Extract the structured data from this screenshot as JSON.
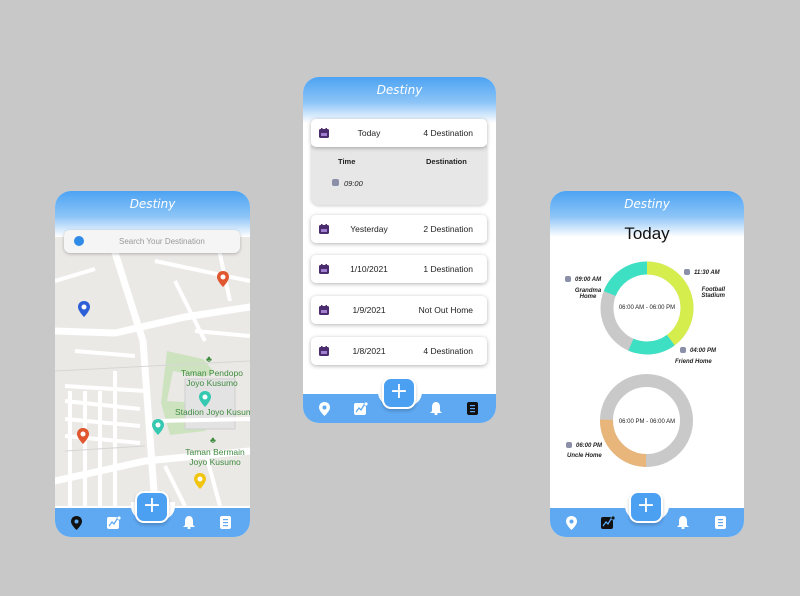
{
  "app": {
    "title": "Destiny"
  },
  "map_screen": {
    "search_placeholder": "Search Your Destination",
    "labels": {
      "pendopo": "Taman Pendopo Joyo Kusumo",
      "stadion": "Stadion Joyo Kusumo",
      "bermain": "Taman Bermain Joyo Kusumo"
    }
  },
  "list_screen": {
    "today": {
      "label": "Today",
      "value": "4 Destination"
    },
    "expanded": {
      "time_header": "Time",
      "destination_header": "Destination",
      "time": "09:00"
    },
    "items": [
      {
        "label": "Yesterday",
        "value": "2 Destination"
      },
      {
        "label": "1/10/2021",
        "value": "1 Destination"
      },
      {
        "label": "1/9/2021",
        "value": "Not Out Home"
      },
      {
        "label": "1/8/2021",
        "value": "4 Destination"
      }
    ]
  },
  "stats_screen": {
    "heading": "Today",
    "ring1": {
      "range": "06:00 AM - 06:00 PM",
      "times": {
        "t1": "09:00 AM",
        "t2": "11:30 AM",
        "t3": "04:00 PM"
      },
      "places": {
        "p1": "Grandma Home",
        "p2": "Football Stadium",
        "p3": "Friend Home"
      }
    },
    "ring2": {
      "range": "06:00 PM - 06:00 AM",
      "time": "06:00 PM",
      "place": "Uncle Home"
    }
  },
  "colors": {
    "primary": "#4ca0f2",
    "ring_yellow": "#d6ee4d",
    "ring_teal": "#3ee0c4",
    "ring_grey": "#c9c9c9",
    "ring_orange": "#e8b67a"
  },
  "nav_icons": [
    "location-pin-icon",
    "chart-icon",
    "bell-icon",
    "list-icon"
  ]
}
